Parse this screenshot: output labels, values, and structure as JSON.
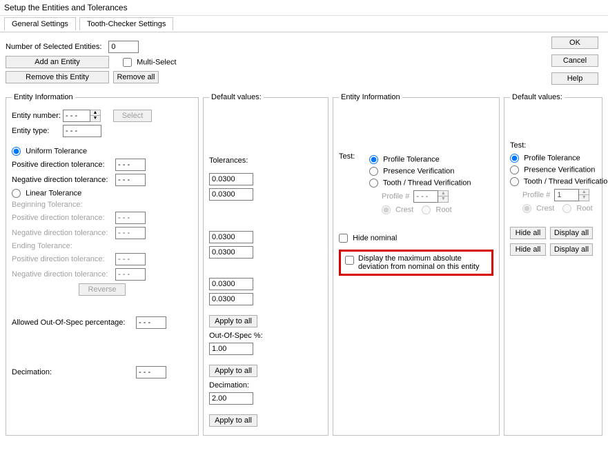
{
  "window": {
    "title": "Setup the Entities and Tolerances"
  },
  "tabs": {
    "general": "General Settings",
    "tooth": "Tooth-Checker Settings"
  },
  "top": {
    "num_selected_label": "Number of Selected Entities:",
    "num_selected_value": "0",
    "add_entity": "Add an Entity",
    "multi_select": "Multi-Select",
    "remove_entity": "Remove this Entity",
    "remove_all": "Remove all"
  },
  "buttons": {
    "ok": "OK",
    "cancel": "Cancel",
    "help": "Help"
  },
  "entity_info": {
    "legend": "Entity Information",
    "entity_number_label": "Entity number:",
    "entity_number_value": "- - -",
    "select": "Select",
    "entity_type_label": "Entity type:",
    "entity_type_value": "- - -",
    "uniform": "Uniform Tolerance",
    "pos_label": "Positive direction tolerance:",
    "neg_label": "Negative direction tolerance:",
    "val_dash": "- - -",
    "linear": "Linear Tolerance",
    "beginning": "Beginning Tolerance:",
    "ending": "Ending Tolerance:",
    "reverse": "Reverse",
    "allowed_oos_label": "Allowed Out-Of-Spec percentage:",
    "decimation_label": "Decimation:"
  },
  "defaults": {
    "legend": "Default values:",
    "tolerances_label": "Tolerances:",
    "t1": "0.0300",
    "t2": "0.0300",
    "t3": "0.0300",
    "t4": "0.0300",
    "t5": "0.0300",
    "t6": "0.0300",
    "apply": "Apply to all",
    "oos_label": "Out-Of-Spec %:",
    "oos_value": "1.00",
    "decimation_label": "Decimation:",
    "decimation_value": "2.00"
  },
  "entity_info2": {
    "legend": "Entity Information",
    "test_label": "Test:",
    "profile_tol": "Profile Tolerance",
    "presence": "Presence Verification",
    "tooth": "Tooth / Thread Verification",
    "profile_num_label": "Profile #",
    "profile_num_value": "- - -",
    "crest": "Crest",
    "root": "Root",
    "hide_nominal": "Hide nominal",
    "display_max": "Display the maximum absolute deviation from nominal on this entity"
  },
  "defaults2": {
    "legend": "Default values:",
    "test_label": "Test:",
    "profile_tol": "Profile Tolerance",
    "presence": "Presence Verification",
    "tooth": "Tooth / Thread Verification",
    "profile_num_label": "Profile #",
    "profile_num_value": "1",
    "crest": "Crest",
    "root": "Root",
    "hide_all": "Hide all",
    "display_all": "Display all"
  }
}
